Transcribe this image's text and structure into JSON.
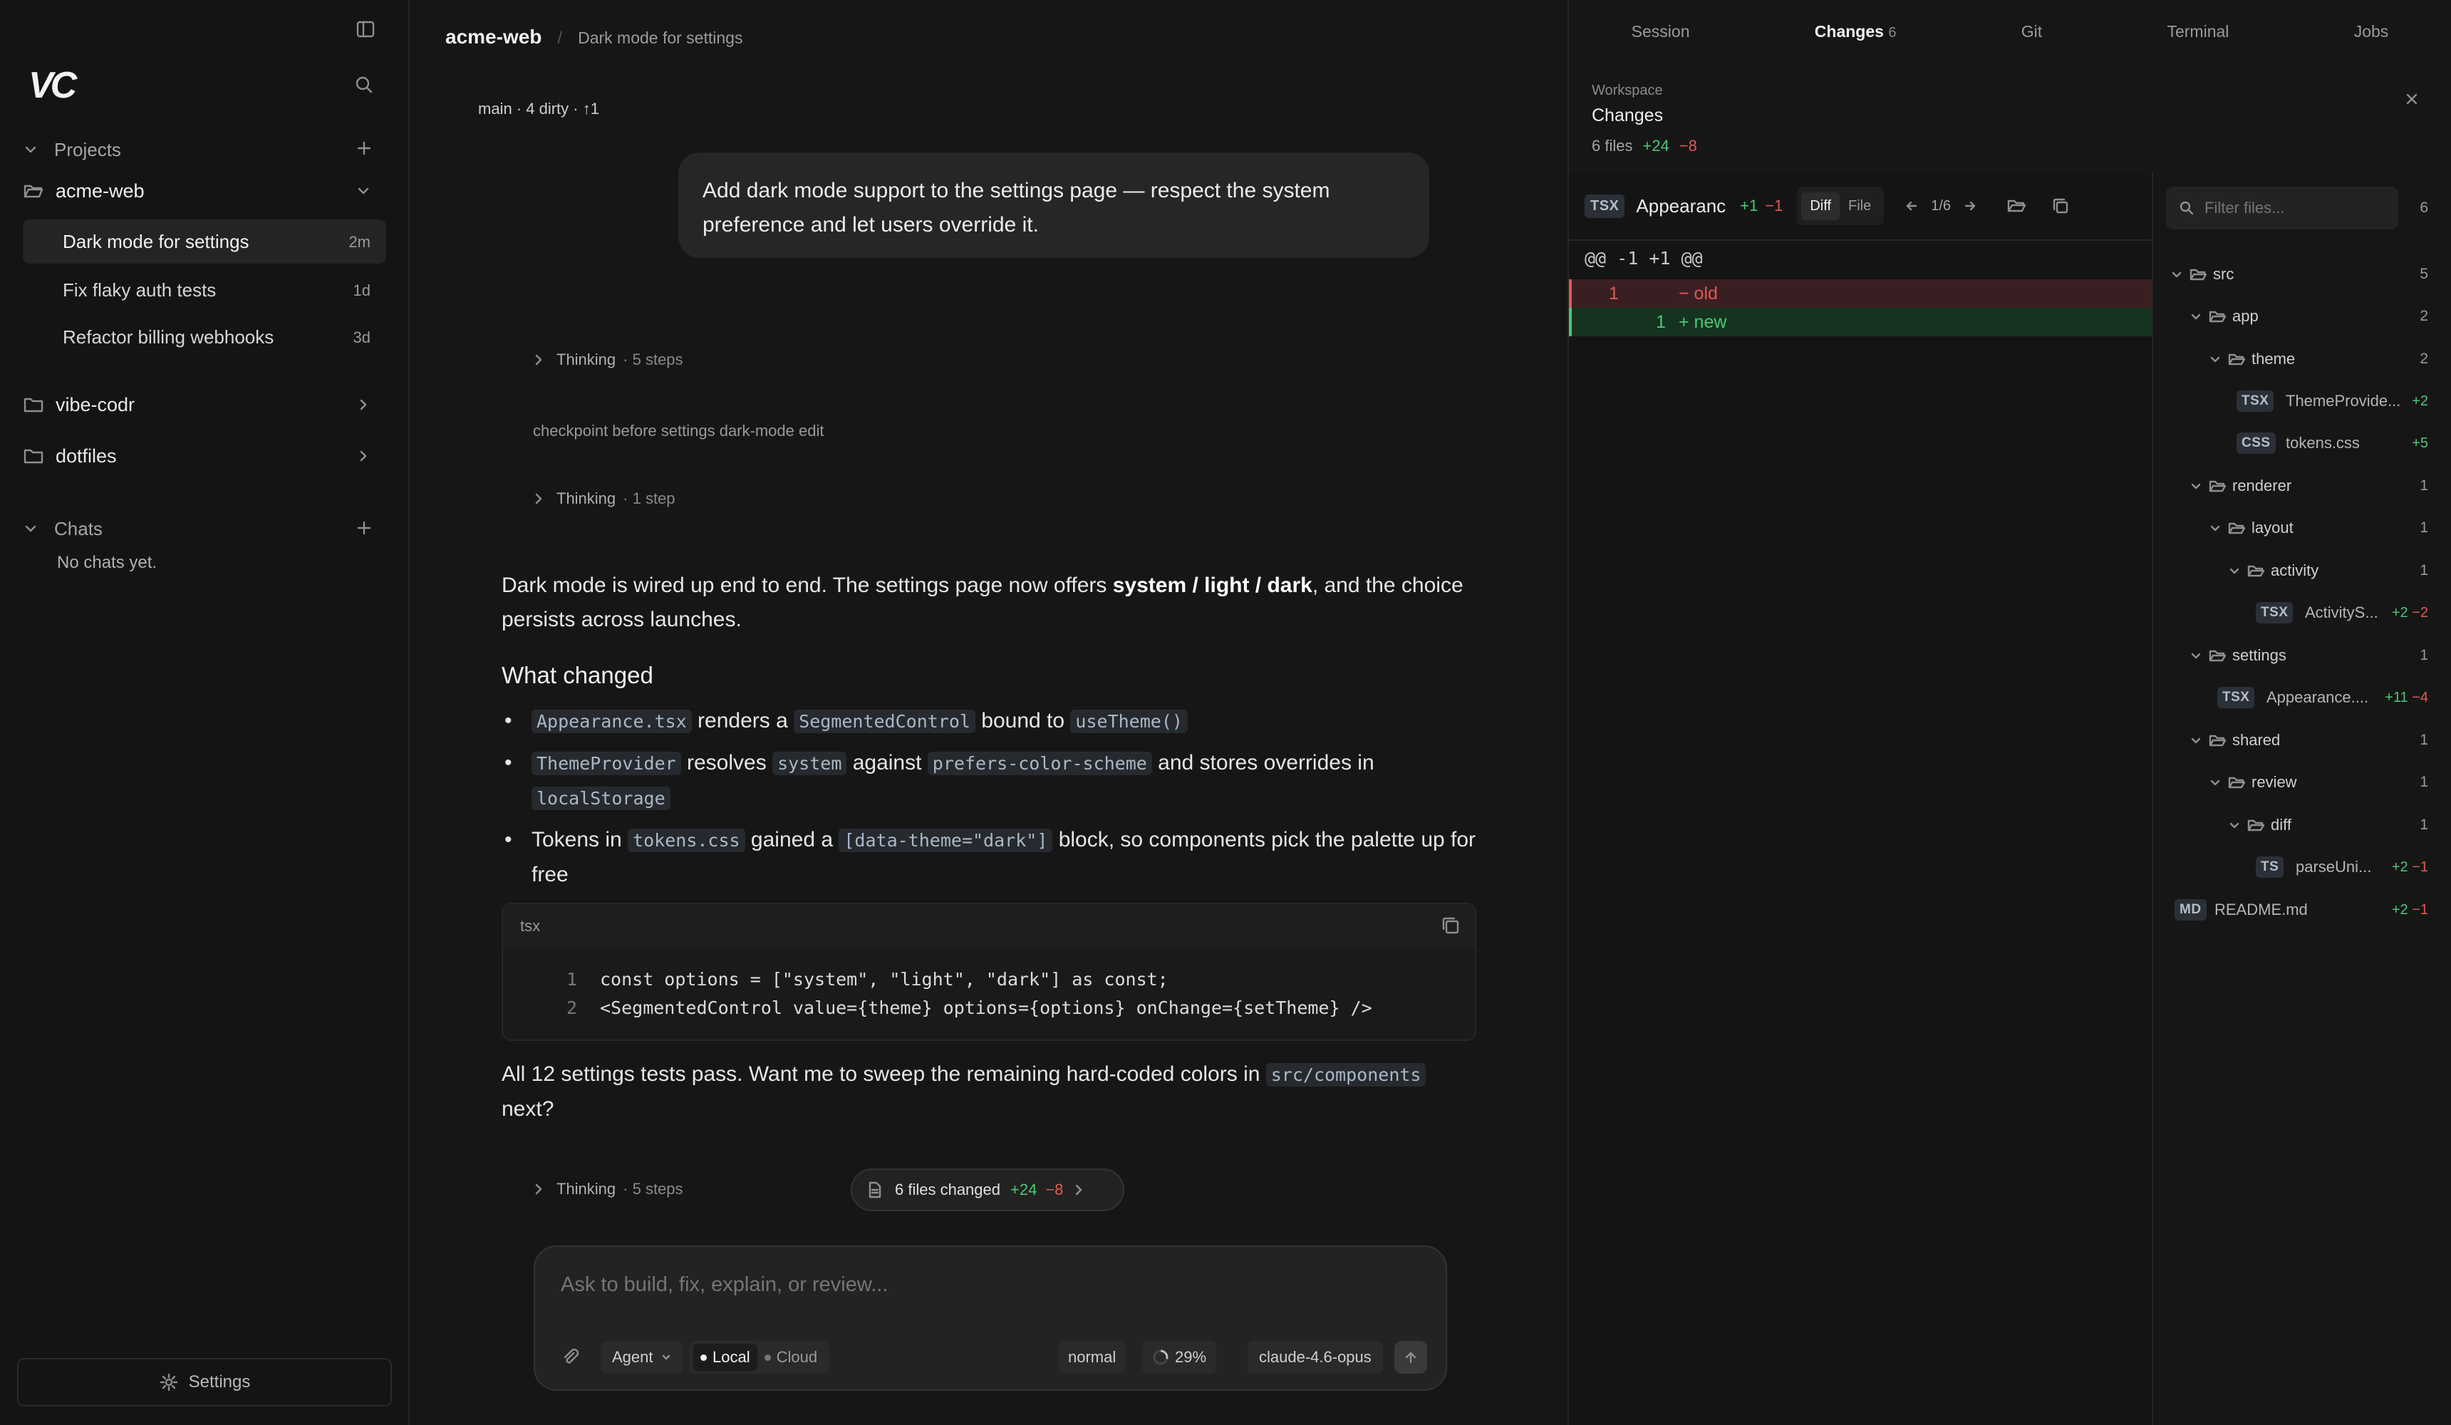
{
  "sidebar": {
    "logo": "VC",
    "projects_label": "Projects",
    "projects": [
      {
        "name": "acme-web"
      },
      {
        "name": "vibe-codr"
      },
      {
        "name": "dotfiles"
      }
    ],
    "tasks": [
      {
        "title": "Dark mode for settings",
        "age": "2m"
      },
      {
        "title": "Fix flaky auth tests",
        "age": "1d"
      },
      {
        "title": "Refactor billing webhooks",
        "age": "3d"
      }
    ],
    "chats_label": "Chats",
    "no_chats": "No chats yet.",
    "settings_label": "Settings"
  },
  "main": {
    "breadcrumb_project": "acme-web",
    "breadcrumb_sep": "/",
    "breadcrumb_task": "Dark mode for settings",
    "branch_status": "main · 4 dirty · ↑1",
    "user_message": "Add dark mode support to the settings page — respect the system preference and let users override it.",
    "thinking1": {
      "label": "Thinking",
      "steps": "· 5 steps"
    },
    "checkpoint": "checkpoint before settings dark-mode edit",
    "thinking2": {
      "label": "Thinking",
      "steps": "· 1 step"
    },
    "reply_intro_1": "Dark mode is wired up end to end. The settings page now offers ",
    "reply_intro_bold": "system / light / dark",
    "reply_intro_2": ", and the choice persists across launches.",
    "what_changed": "What changed",
    "b1": {
      "code1": "Appearance.tsx",
      "t1": " renders a ",
      "code2": "SegmentedControl",
      "t2": " bound to ",
      "code3": "useTheme()"
    },
    "b2": {
      "code1": "ThemeProvider",
      "t1": " resolves ",
      "code2": "system",
      "t2": " against ",
      "code3": "prefers-color-scheme",
      "t3": " and stores overrides in ",
      "code4": "localStorage"
    },
    "b3": {
      "t0": "Tokens in ",
      "code1": "tokens.css",
      "t1": " gained a ",
      "code2": "[data-theme=\"dark\"]",
      "t2": " block, so components pick the palette up for free"
    },
    "codeblock": {
      "lang": "tsx",
      "lines": [
        {
          "n": "1",
          "text": "const options = [\"system\", \"light\", \"dark\"] as const;"
        },
        {
          "n": "2",
          "text": "<SegmentedControl value={theme} options={options} onChange={setTheme} />"
        }
      ]
    },
    "closing_1": "All 12 settings tests pass. Want me to sweep the remaining hard-coded colors in ",
    "closing_code": "src/components",
    "closing_2": "next?",
    "thinking3": {
      "label": "Thinking",
      "steps": "· 5 steps"
    },
    "files_changed": {
      "label": "6 files changed",
      "add": "+24",
      "del": "−8"
    },
    "composer": {
      "placeholder": "Ask to build, fix, explain, or review...",
      "agent": "Agent",
      "local": "Local",
      "cloud": "Cloud",
      "mode": "normal",
      "context": "29%",
      "model": "claude-4.6-opus"
    }
  },
  "right": {
    "tabs": [
      {
        "label": "Session"
      },
      {
        "label": "Changes",
        "count": "6"
      },
      {
        "label": "Git"
      },
      {
        "label": "Terminal"
      },
      {
        "label": "Jobs"
      }
    ],
    "workspace_label": "Workspace",
    "changes_title": "Changes",
    "summary_files": "6 files",
    "summary_add": "+24",
    "summary_del": "−8",
    "diff": {
      "badge": "TSX",
      "filename": "Appearanc",
      "add": "+1",
      "del": "−1",
      "diff_tab": "Diff",
      "file_tab": "File",
      "pager": "1/6",
      "hunk": "@@ -1 +1 @@",
      "old_line_no": "1",
      "old_text": "− old",
      "new_line_no": "1",
      "new_text": "+ new"
    },
    "filter_placeholder": "Filter files...",
    "filter_count": "6",
    "tree": [
      {
        "kind": "dir",
        "name": "src",
        "count": "5"
      },
      {
        "kind": "dir",
        "name": "app",
        "count": "2"
      },
      {
        "kind": "dir",
        "name": "theme",
        "count": "2"
      },
      {
        "kind": "file",
        "badge": "TSX",
        "name": "ThemeProvide...",
        "add": "+2",
        "del": ""
      },
      {
        "kind": "file",
        "badge": "CSS",
        "name": "tokens.css",
        "add": "+5",
        "del": ""
      },
      {
        "kind": "dir",
        "name": "renderer",
        "count": "1"
      },
      {
        "kind": "dir",
        "name": "layout",
        "count": "1"
      },
      {
        "kind": "dir",
        "name": "activity",
        "count": "1"
      },
      {
        "kind": "file",
        "badge": "TSX",
        "name": "ActivityS...",
        "add": "+2",
        "del": "−2"
      },
      {
        "kind": "dir",
        "name": "settings",
        "count": "1"
      },
      {
        "kind": "file",
        "badge": "TSX",
        "name": "Appearance....",
        "add": "+11",
        "del": "−4"
      },
      {
        "kind": "dir",
        "name": "shared",
        "count": "1"
      },
      {
        "kind": "dir",
        "name": "review",
        "count": "1"
      },
      {
        "kind": "dir",
        "name": "diff",
        "count": "1"
      },
      {
        "kind": "file",
        "badge": "TS",
        "name": "parseUni...",
        "add": "+2",
        "del": "−1"
      },
      {
        "kind": "file",
        "badge": "MD",
        "name": "README.md",
        "add": "+2",
        "del": "−1"
      }
    ]
  }
}
